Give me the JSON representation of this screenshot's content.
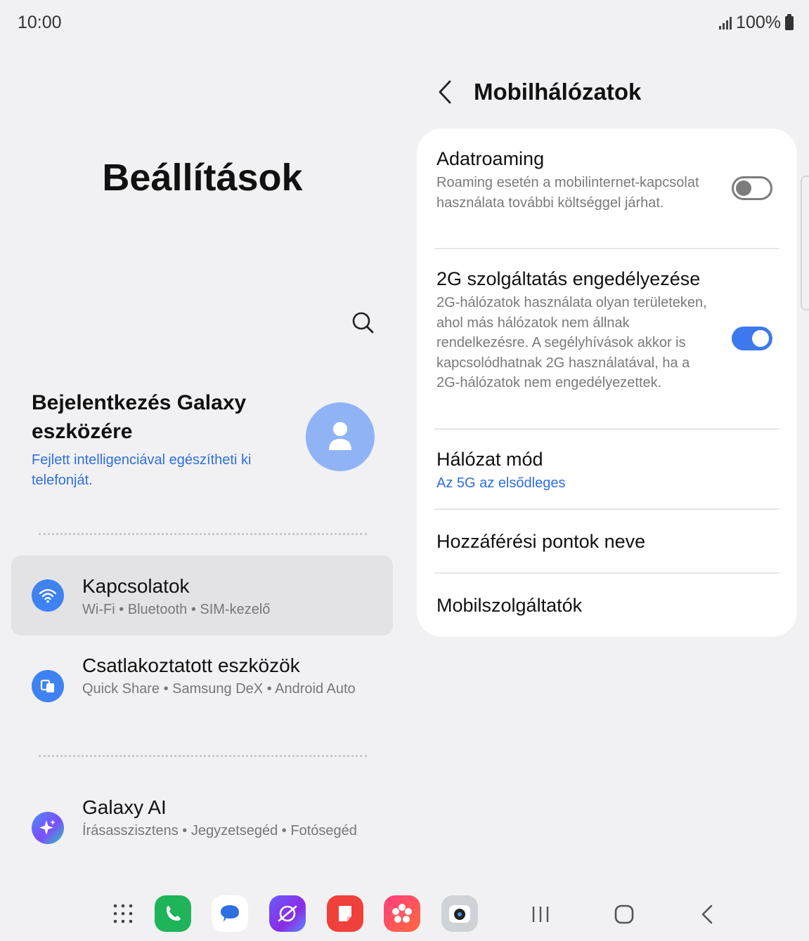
{
  "status": {
    "time": "10:00",
    "battery": "100%"
  },
  "left": {
    "title": "Beállítások",
    "account": {
      "title": "Bejelentkezés Galaxy eszközére",
      "subtitle": "Fejlett intelligenciával egészítheti ki telefonját."
    },
    "items": [
      {
        "title": "Kapcsolatok",
        "subtitle": "Wi-Fi  •  Bluetooth  •  SIM-kezelő",
        "color": "#3f82f2",
        "icon": "wifi-icon"
      },
      {
        "title": "Csatlakoztatott eszközök",
        "subtitle": "Quick Share  •  Samsung DeX  •  Android Auto",
        "color": "#3f82f2",
        "icon": "devices-icon"
      },
      {
        "title": "Galaxy AI",
        "subtitle": "Írásasszisztens  •  Jegyzetsegéd  •  Fotósegéd",
        "icon": "sparkle-icon"
      }
    ]
  },
  "right": {
    "title": "Mobilhálózatok",
    "rows": [
      {
        "title": "Adatroaming",
        "subtitle": "Roaming esetén a mobilinternet-kapcsolat használata további költséggel járhat.",
        "toggle": "off"
      },
      {
        "title": "2G szolgáltatás engedélyezése",
        "subtitle": "2G-hálózatok használata olyan területeken, ahol más hálózatok nem állnak rendelkezésre. A segélyhívások akkor is kapcsolódhatnak 2G használatával, ha a 2G-hálózatok nem engedélyezettek.",
        "toggle": "on"
      },
      {
        "title": "Hálózat mód",
        "subtitle": "Az 5G az elsődleges"
      },
      {
        "title": "Hozzáférési pontok neve"
      },
      {
        "title": "Mobilszolgáltatók"
      }
    ]
  },
  "colors": {
    "accent": "#3d78ee",
    "link": "#2f6ee0",
    "background": "#f1f1f3"
  }
}
